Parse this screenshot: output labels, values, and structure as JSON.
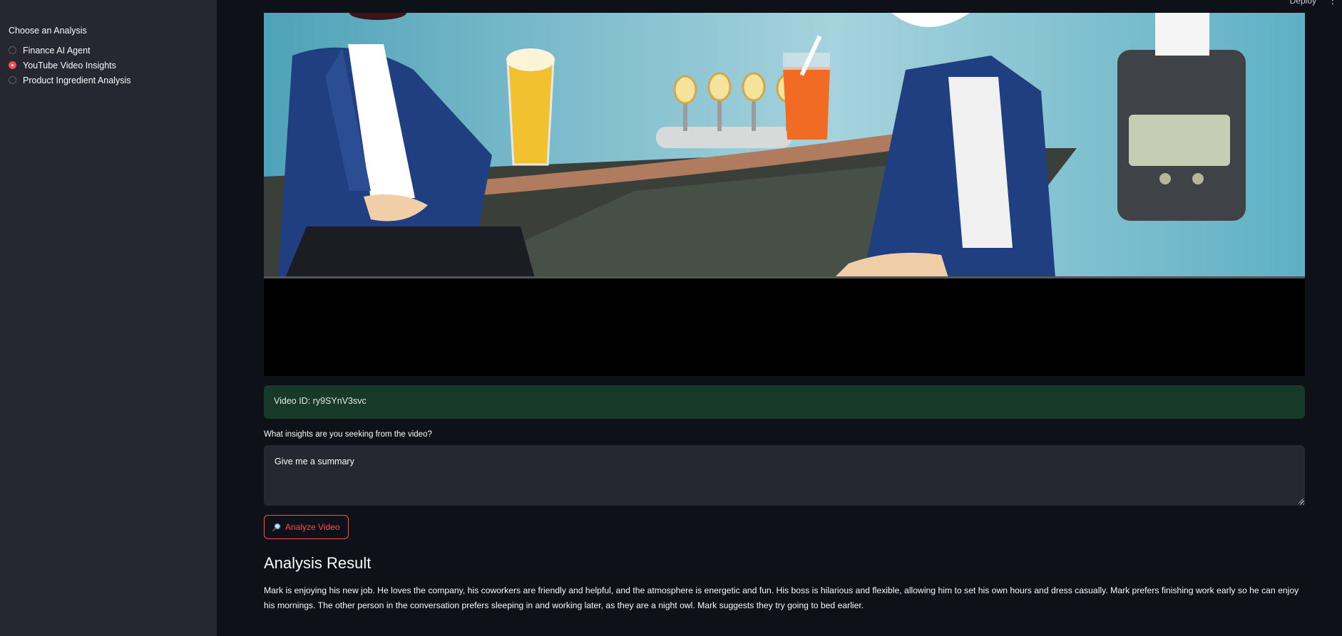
{
  "sidebar": {
    "title": "Choose an Analysis",
    "options": [
      {
        "label": "Finance AI Agent",
        "selected": false
      },
      {
        "label": "YouTube Video Insights",
        "selected": true
      },
      {
        "label": "Product Ingredient Analysis",
        "selected": false
      }
    ]
  },
  "header": {
    "deploy_label": "Deploy",
    "menu_icon": "vertical-dots-icon"
  },
  "main": {
    "video_info": "Video ID: ry9SYnV3svc",
    "question_label": "What insights are you seeking from the video?",
    "question_value": "Give me a summary",
    "analyze_button": {
      "icon": "magnifier-icon",
      "label": "Analyze Video"
    },
    "result_title": "Analysis Result",
    "result_text": "Mark is enjoying his new job. He loves the company, his coworkers are friendly and helpful, and the atmosphere is energetic and fun. His boss is hilarious and flexible, allowing him to set his own hours and dress casually. Mark prefers finishing work early so he can enjoy his mornings. The other person in the conversation prefers sleeping in and working later, as they are a night owl. Mark suggests they try going to bed earlier."
  },
  "colors": {
    "background": "#0e1117",
    "sidebar": "#262730",
    "accent": "#ff4b4b",
    "info_box": "#173928"
  }
}
